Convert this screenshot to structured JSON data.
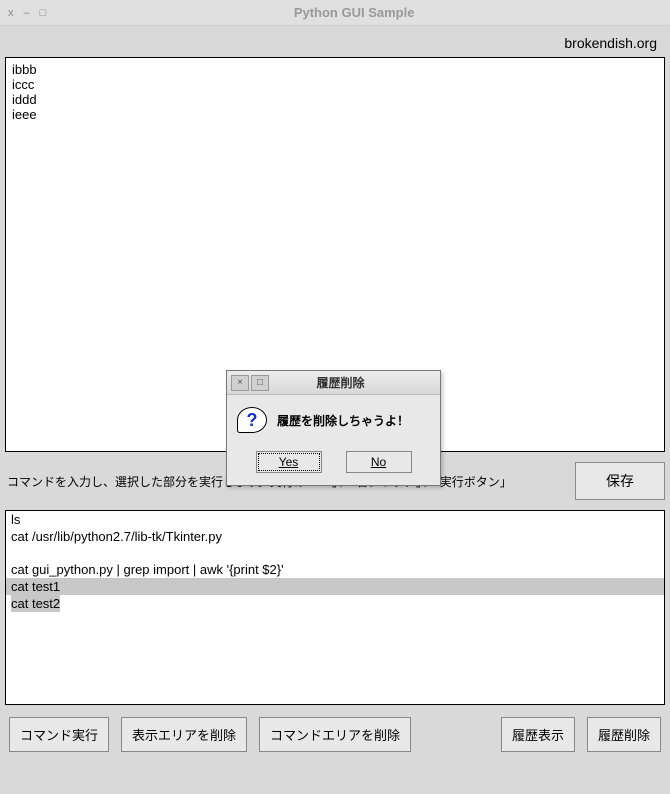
{
  "window": {
    "title": "Python GUI Sample",
    "close_icon": "x",
    "min_icon": "–",
    "max_icon": "□"
  },
  "site_label": "brokendish.org",
  "display_content": "ibbb\niccc\niddd\nieee",
  "instruction": "コマンドを入力し、選択した部分を実行します。実行は「F1」、「右クリック」、「実行ボタン」",
  "save_button": "保存",
  "command_lines": [
    {
      "text": "ls",
      "selected": false
    },
    {
      "text": "cat /usr/lib/python2.7/lib-tk/Tkinter.py",
      "selected": false
    },
    {
      "text": "",
      "selected": false
    },
    {
      "text": "cat gui_python.py | grep import | awk '{print $2}'",
      "selected": false
    },
    {
      "text": "cat test1",
      "selected": true
    },
    {
      "text": "cat test2",
      "selected": false,
      "cursor": true
    }
  ],
  "buttons": {
    "exec": "コマンド実行",
    "clear_display": "表示エリアを削除",
    "clear_command": "コマンドエリアを削除",
    "hist_show": "履歴表示",
    "hist_delete": "履歴削除"
  },
  "dialog": {
    "title": "履歴削除",
    "message": "履歴を削除しちゃうよ！",
    "yes": "Yes",
    "no": "No",
    "close_icon": "×",
    "max_icon": "□"
  }
}
